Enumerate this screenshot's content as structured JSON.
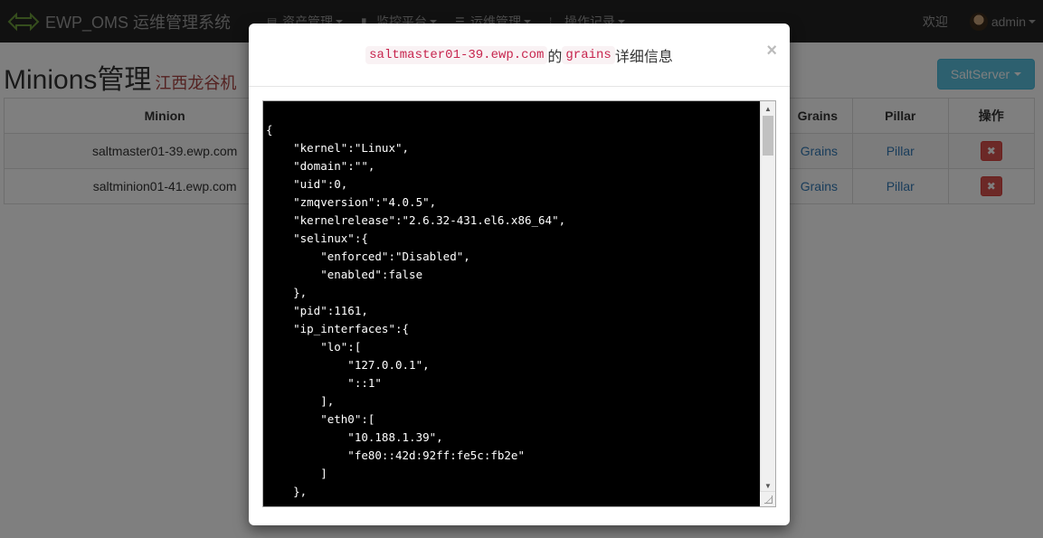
{
  "navbar": {
    "brand": "EWP_OMS 运维管理系统",
    "menu": [
      {
        "label": "资产管理",
        "icon": "list-icon"
      },
      {
        "label": "监控平台",
        "icon": "bar-chart-icon"
      },
      {
        "label": "运维管理",
        "icon": "tasks-icon"
      },
      {
        "label": "操作记录",
        "icon": "th-icon"
      }
    ],
    "welcome": "欢迎",
    "user": "admin"
  },
  "page": {
    "title": "Minions管理",
    "subtitle": "江西龙谷机",
    "salt_button": "SaltServer"
  },
  "table": {
    "headers": [
      "Minion",
      "Grains",
      "Pillar",
      "操作"
    ],
    "rows": [
      {
        "minion": "saltmaster01-39.ewp.com",
        "grains": "Grains",
        "pillar": "Pillar"
      },
      {
        "minion": "saltminion01-41.ewp.com",
        "grains": "Grains",
        "pillar": "Pillar"
      }
    ],
    "visible_grains_text": "rains"
  },
  "modal": {
    "title_host": "saltmaster01-39.ewp.com",
    "title_of": "的",
    "title_key": "grains",
    "title_suffix": "详细信息",
    "close": "×",
    "json_text": "{\n    \"kernel\":\"Linux\",\n    \"domain\":\"\",\n    \"uid\":0,\n    \"zmqversion\":\"4.0.5\",\n    \"kernelrelease\":\"2.6.32-431.el6.x86_64\",\n    \"selinux\":{\n        \"enforced\":\"Disabled\",\n        \"enabled\":false\n    },\n    \"pid\":1161,\n    \"ip_interfaces\":{\n        \"lo\":[\n            \"127.0.0.1\",\n            \"::1\"\n        ],\n        \"eth0\":[\n            \"10.188.1.39\",\n            \"fe80::42d:92ff:fe5c:fb2e\"\n        ]\n    },"
  },
  "colors": {
    "navbar_bg": "#222222",
    "info_button": "#5bc0de",
    "danger_button": "#d9534f",
    "code_text": "#c7254e"
  }
}
